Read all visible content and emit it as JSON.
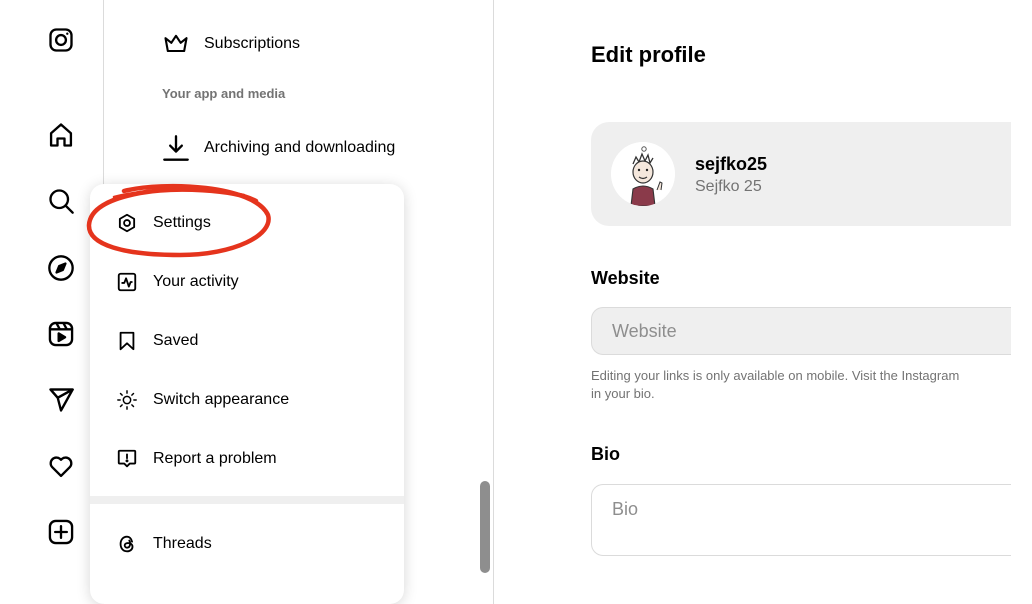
{
  "settings_column": {
    "subscriptions_label": "Subscriptions",
    "section_app_media": "Your app and media",
    "archiving_label": "Archiving and downloading"
  },
  "more_menu": {
    "items": [
      {
        "label": "Settings",
        "icon": "gear-icon"
      },
      {
        "label": "Your activity",
        "icon": "activity-icon"
      },
      {
        "label": "Saved",
        "icon": "bookmark-icon"
      },
      {
        "label": "Switch appearance",
        "icon": "sun-icon"
      },
      {
        "label": "Report a problem",
        "icon": "report-icon"
      },
      {
        "label": "Threads",
        "icon": "threads-icon"
      }
    ]
  },
  "edit_profile": {
    "title": "Edit profile",
    "username": "sejfko25",
    "full_name": "Sejfko 25",
    "website_label": "Website",
    "website_placeholder": "Website",
    "website_hint_line1": "Editing your links is only available on mobile. Visit the Instagram",
    "website_hint_line2": "in your bio.",
    "bio_label": "Bio",
    "bio_placeholder": "Bio"
  },
  "colors": {
    "annotation": "#e5341d",
    "card_bg": "#efefef",
    "muted_text": "#737373"
  }
}
